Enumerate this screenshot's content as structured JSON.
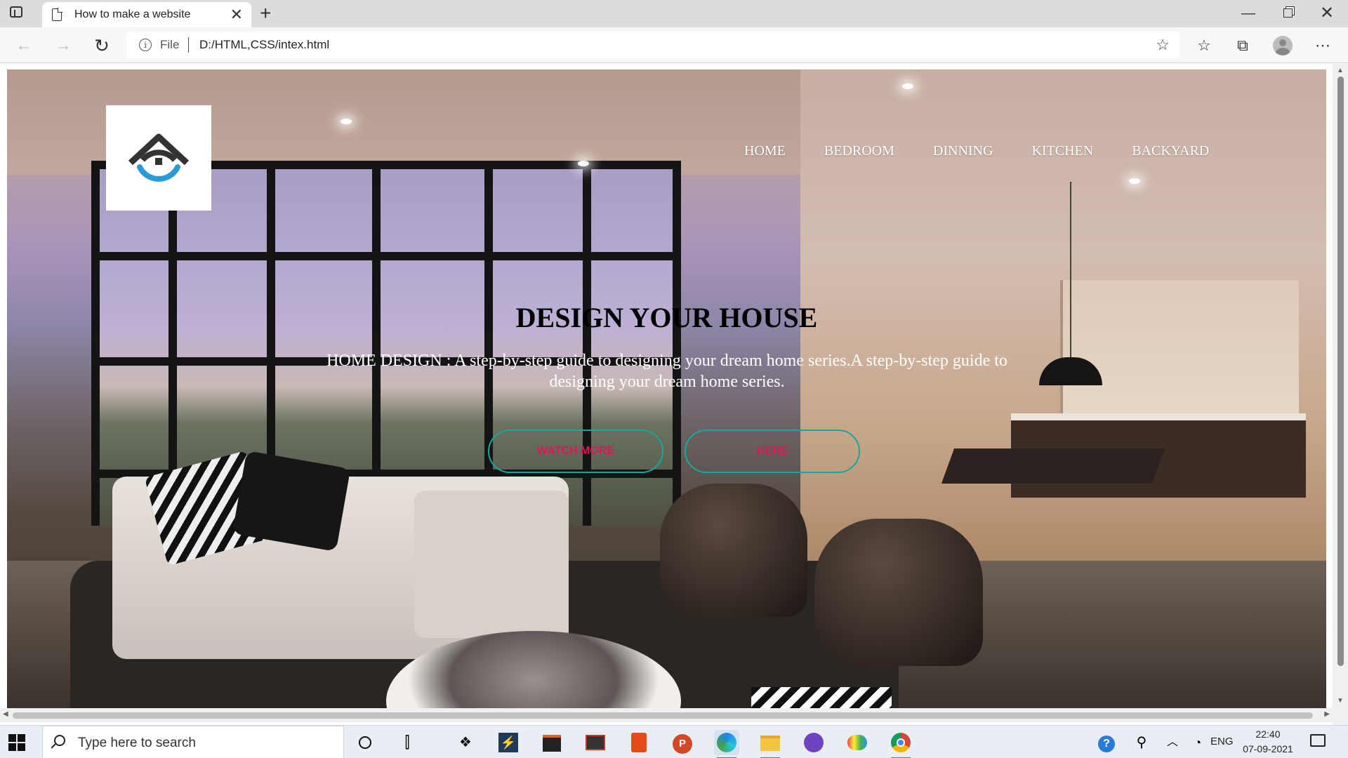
{
  "browser": {
    "tab_title": "How to make a website",
    "tab_close": "✕",
    "new_tab": "+",
    "url_scheme": "File",
    "url": "D:/HTML,CSS/intex.html",
    "window_min": "—",
    "window_close": "✕"
  },
  "site": {
    "nav": [
      "HOME",
      "BEDROOM",
      "DINNING",
      "KITCHEN",
      "BACKYARD"
    ],
    "headline": "DESIGN YOUR HOUSE",
    "subtext": "HOME DESIGN : A step-by-step guide to designing your dream home series.A step-by-step guide to designing your dream home series.",
    "buttons": [
      "WATCH MORE",
      "HERE"
    ],
    "accent_border": "#14a99a",
    "button_text_color": "#e0155a"
  },
  "taskbar": {
    "search_placeholder": "Type here to search",
    "language": "ENG",
    "time": "22:40",
    "date": "07-09-2021",
    "apps": [
      "cortana-icon",
      "task-view-icon",
      "dropbox-icon",
      "visual-studio-icon",
      "store-icon",
      "photo-icon",
      "office-icon",
      "powerpoint-icon",
      "edge-icon",
      "file-explorer-icon",
      "github-icon",
      "paint-icon",
      "chrome-icon"
    ]
  }
}
